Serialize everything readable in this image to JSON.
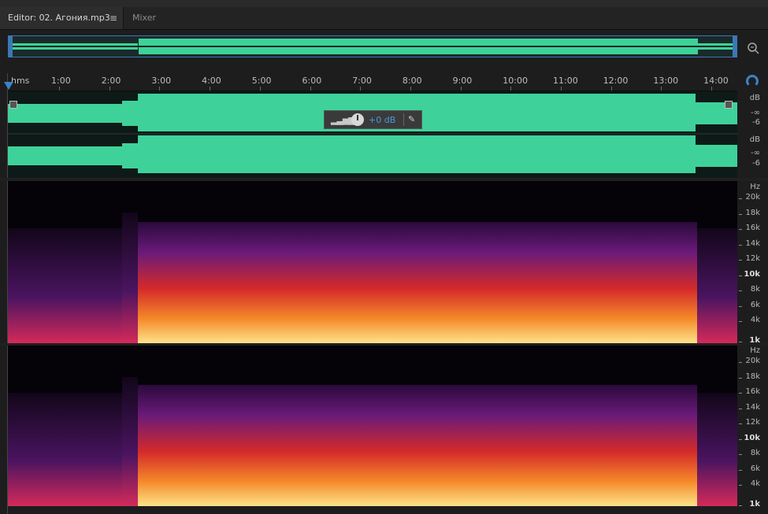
{
  "tabs": {
    "editor_label": "Editor: 02. Агония.mp3",
    "mixer_label": "Mixer",
    "menu_glyph": "≡"
  },
  "ruler": {
    "unit": "hms",
    "labels": [
      "1:00",
      "2:00",
      "3:00",
      "4:00",
      "5:00",
      "6:00",
      "7:00",
      "8:00",
      "9:00",
      "10:00",
      "11:00",
      "12:00",
      "13:00",
      "14:00"
    ]
  },
  "amplitude_scale": {
    "unit": "dB",
    "marks": [
      "-∞",
      "-6"
    ]
  },
  "hud": {
    "value": "+0 dB",
    "bars_glyph": "▂▃▅▆▇",
    "pin_glyph": "✎"
  },
  "frequency_scale": {
    "unit": "Hz",
    "labels": [
      "20k",
      "18k",
      "16k",
      "14k",
      "12k",
      "10k",
      "8k",
      "6k",
      "4k",
      "1k"
    ],
    "bold": [
      "10k",
      "1k"
    ]
  },
  "colors": {
    "waveform": "#3ed29a",
    "accent": "#3b82c6",
    "spectrum_low": "#fde38a",
    "spectrum_mid": "#f0401e",
    "spectrum_high": "#6a1a7a"
  },
  "icons": {
    "zoom": "zoom-icon",
    "headphones": "headphones-icon",
    "menu": "menu-icon",
    "pin": "pin-icon"
  }
}
